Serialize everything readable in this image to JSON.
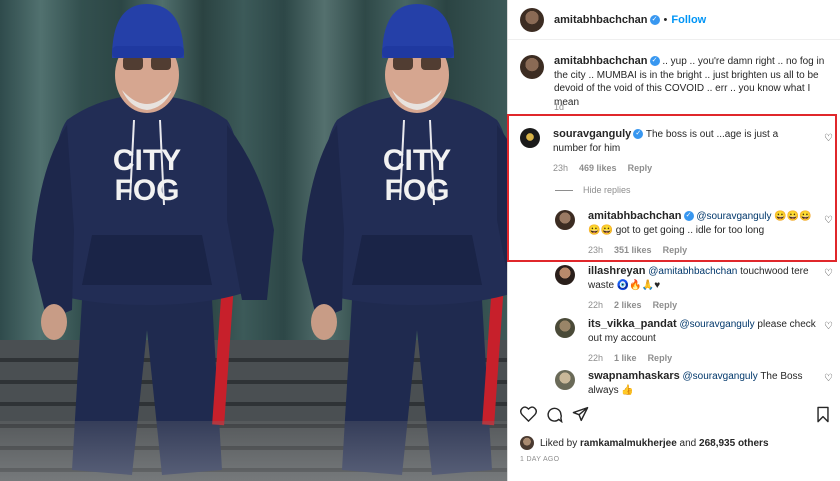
{
  "post": {
    "owner": "amitabhbachchan",
    "follow_label": "Follow",
    "dot": "•",
    "caption_user": "amitabhbachchan",
    "caption_text": ".. yup .. you're damn right .. no fog in the city .. MUMBAI is in the bright .. just brighten us all to be devoid of the void of this COVOID .. err .. you know what I mean",
    "caption_time": "1d",
    "hoodie_text_line1": "CITY",
    "hoodie_text_line2": "FOG"
  },
  "comments": [
    {
      "user": "souravganguly",
      "verified": true,
      "text": "The boss is out ...age is just a number for him",
      "time": "23h",
      "likes": "469 likes",
      "reply_label": "Reply",
      "hide_replies_label": "Hide replies",
      "replies": [
        {
          "user": "amitabhbachchan",
          "verified": true,
          "mention": "@souravganguly",
          "emoji": "😀😀😀😀😀",
          "text": "got to get going .. idle for too long",
          "time": "23h",
          "likes": "351 likes",
          "reply_label": "Reply"
        }
      ]
    },
    {
      "user": "illashreyan",
      "mention": "@amitabhbachchan",
      "text": "touchwood tere waste",
      "emoji": "🧿🔥🙏♥",
      "time": "22h",
      "likes": "2 likes",
      "reply_label": "Reply"
    },
    {
      "user": "its_vikka_pandat",
      "mention": "@souravganguly",
      "text": "please check out my account",
      "time": "22h",
      "likes": "1 like",
      "reply_label": "Reply"
    },
    {
      "user": "swapnamhaskars",
      "mention": "@souravganguly",
      "text": "The Boss always",
      "emoji": "👍"
    }
  ],
  "likes_bar": {
    "prefix": "Liked by ",
    "liked_by": "ramkamalmukherjee",
    "middle": " and ",
    "others": "268,935 others",
    "date": "1 DAY AGO"
  },
  "icons": [
    "heart-icon",
    "comment-icon",
    "share-icon",
    "bookmark-icon",
    "verified-badge-icon"
  ],
  "colors": {
    "accent_blue": "#0095f6",
    "verified_blue": "#3897f0",
    "highlight_red": "#e0272b",
    "muted_text": "#8e8e8e",
    "hoodie_navy": "#1f2a4f",
    "beanie_blue": "#2540a8"
  }
}
